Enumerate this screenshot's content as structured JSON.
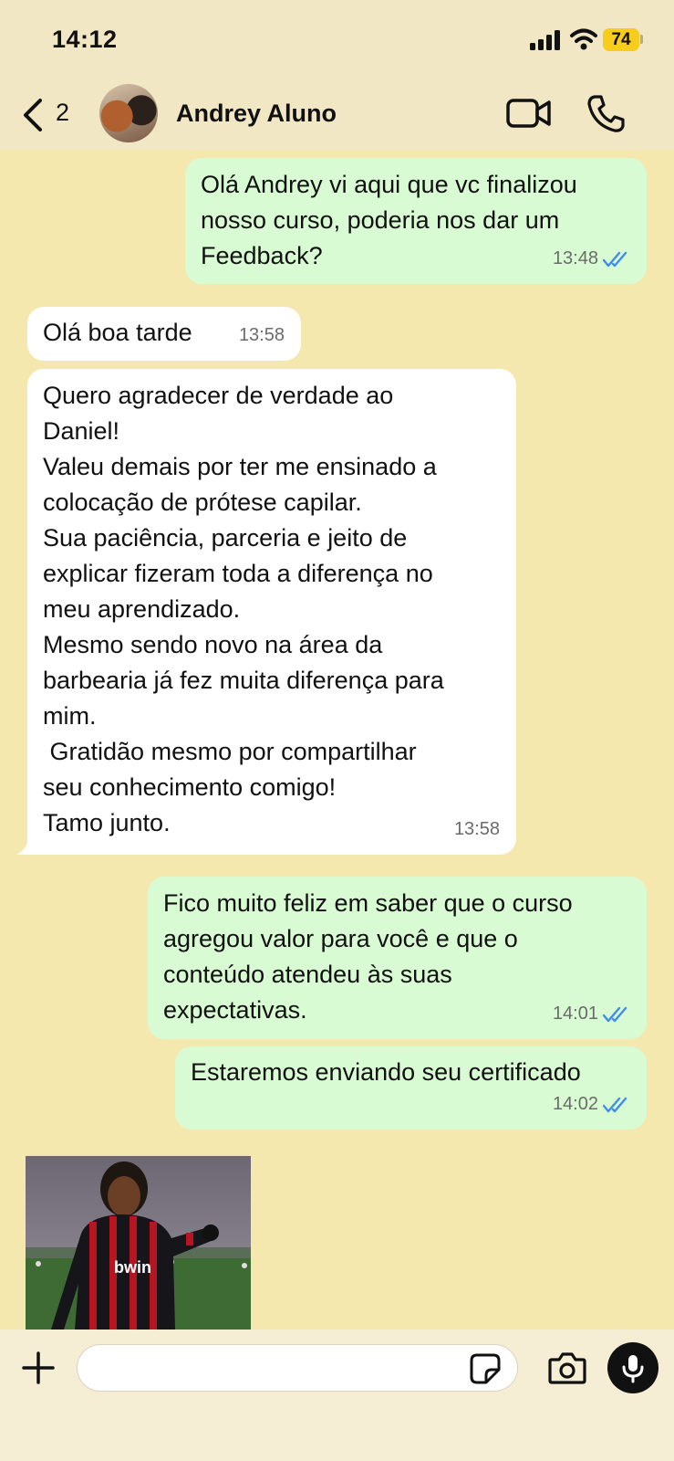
{
  "status": {
    "time": "14:12",
    "battery": "74"
  },
  "header": {
    "unread_count": "2",
    "contact_name": "Andrey Aluno"
  },
  "messages": [
    {
      "text": "Olá Andrey vi aqui que vc finalizou\nnosso curso, poderia nos dar um\nFeedback?",
      "time": "13:48"
    },
    {
      "text": "Olá boa tarde",
      "time": "13:58"
    },
    {
      "text": "Quero agradecer de verdade ao\nDaniel!\nValeu demais por ter me ensinado a\ncolocação de prótese capilar.\nSua paciência, parceria e jeito de\nexplicar fizeram toda a diferença no\nmeu aprendizado.\nMesmo sendo novo na área da\nbarbearia já fez muita diferença para\nmim.\n Gratidão mesmo por compartilhar\nseu conhecimento comigo!\nTamo junto.",
      "time": "13:58"
    },
    {
      "text": "Fico muito feliz em saber que o curso\nagregou valor para você e que o\nconteúdo atendeu às suas\nexpectativas.",
      "time": "14:01"
    },
    {
      "text": "Estaremos enviando seu certificado",
      "time": "14:02"
    }
  ],
  "gif_jersey_text": "bwin",
  "colors": {
    "outgoing": "#d9fbd3",
    "incoming": "#ffffff",
    "background": "#f5e8ae",
    "read_ticks": "#3f8cf0"
  }
}
